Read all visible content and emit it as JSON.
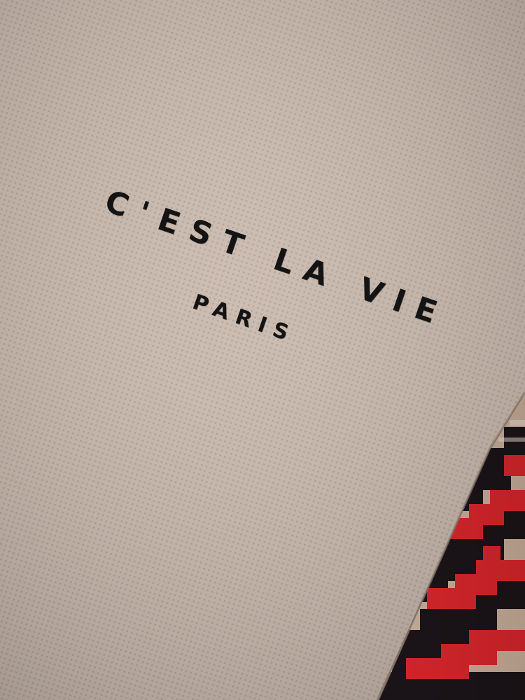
{
  "image": {
    "subject": "knit-fabric-closeup",
    "colors": {
      "fabric": "#c9b9ad",
      "fabric_shadow": "#a8968a",
      "embroidery": "#141414",
      "pattern_red": "#d8262b",
      "pattern_black": "#1b1418",
      "pattern_tan": "#c8ad99"
    }
  },
  "embroidery": {
    "line1": "C'EST LA VIE",
    "line2": "PARIS"
  }
}
